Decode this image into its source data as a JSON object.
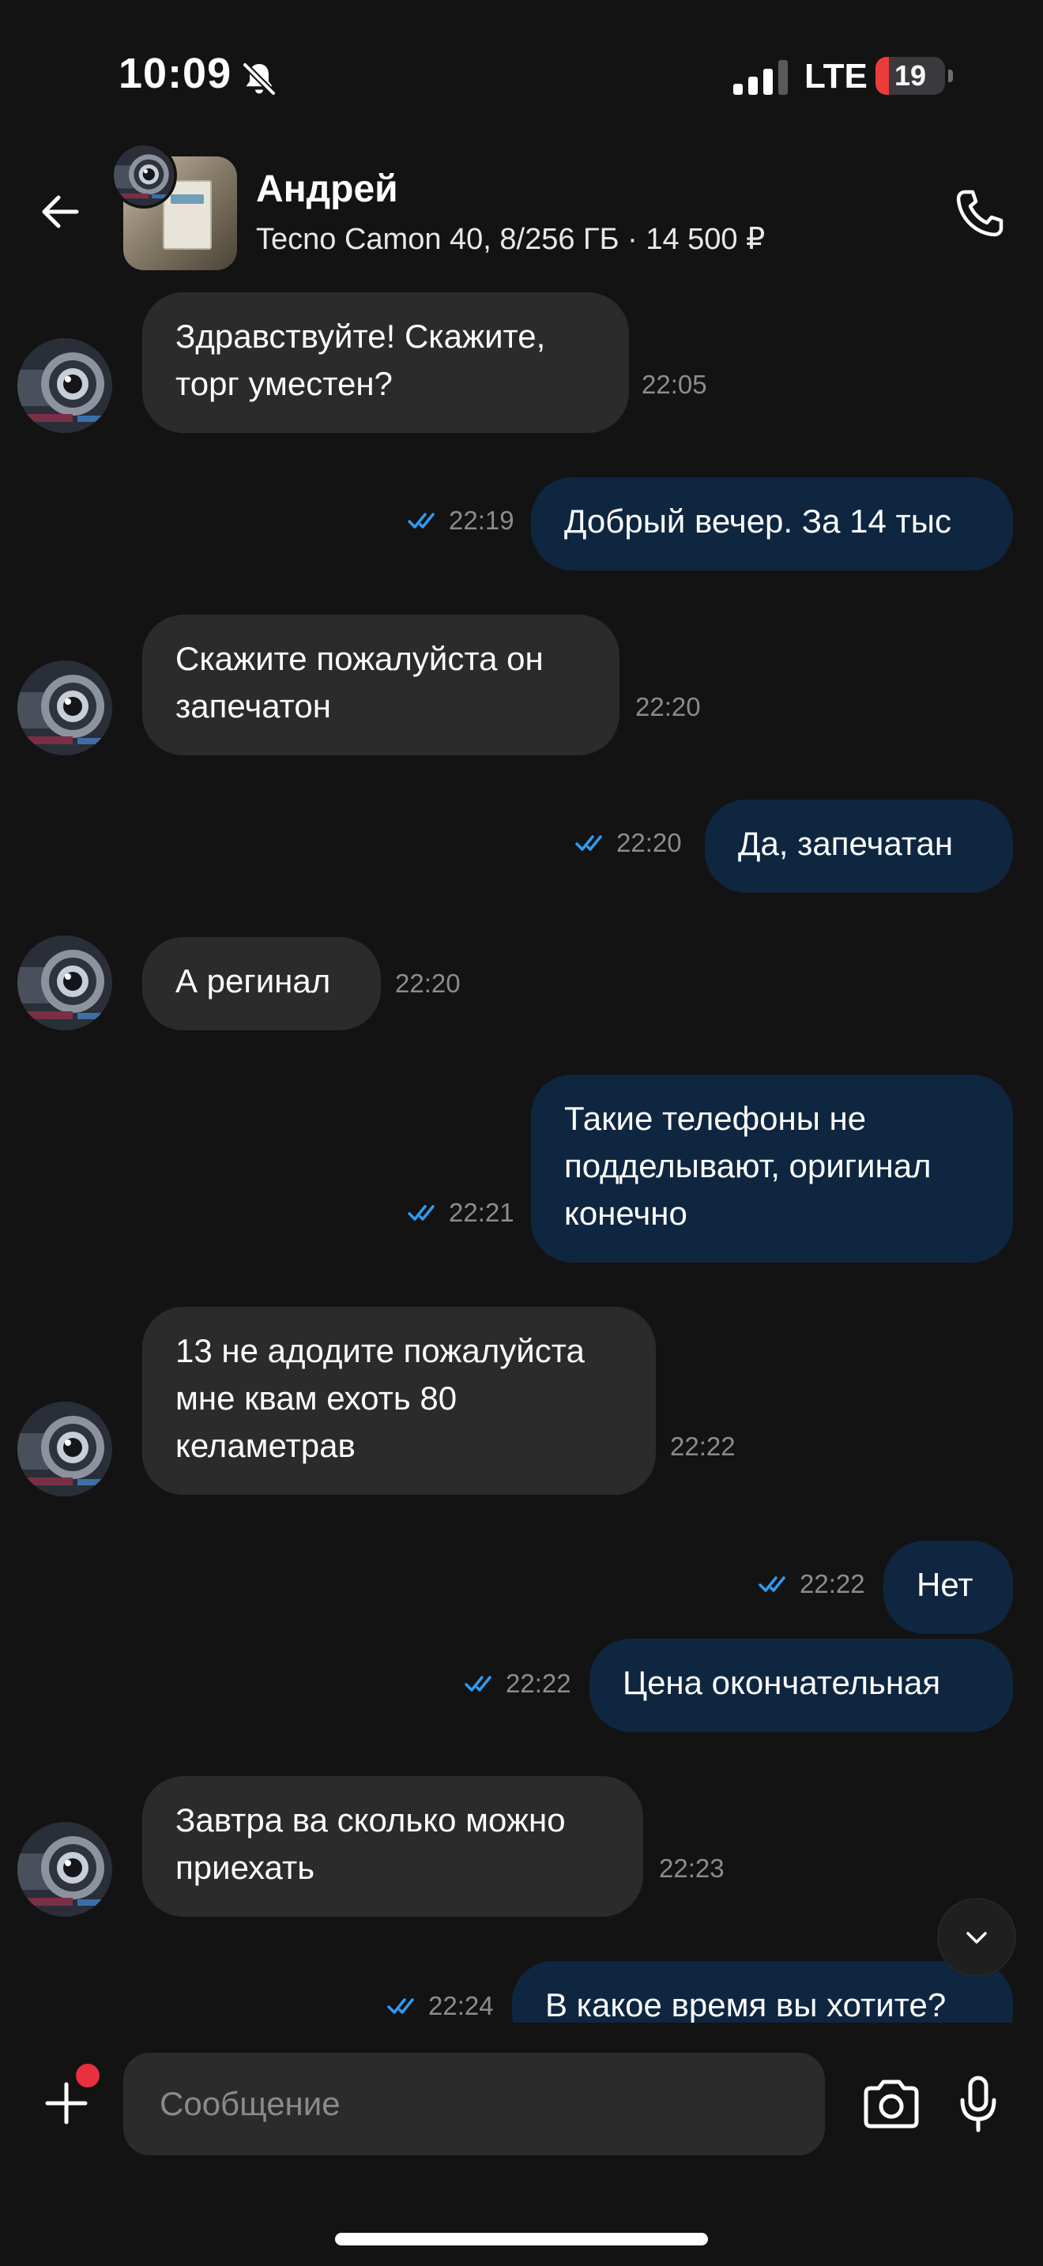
{
  "status_bar": {
    "time": "10:09",
    "network": "LTE",
    "battery_level": "19",
    "battery_fraction": 0.19,
    "battery_color": "#eb3b3b",
    "icons": [
      "bell-slash-icon",
      "signal-icon"
    ]
  },
  "header": {
    "contact_name": "Андрей",
    "listing_title": "Tecno Camon 40, 8/256 ГБ · 14 500 ₽",
    "icons": [
      "back-arrow-icon",
      "phone-icon"
    ]
  },
  "colors": {
    "background": "#131313",
    "incoming_bubble": "#2b2b2b",
    "outgoing_bubble": "#0f2640",
    "read_check": "#2f9bf2",
    "timestamp": "#8c8c8c"
  },
  "messages": [
    {
      "direction": "in",
      "text": "Здравствуйте! Скажите,\nторг уместен?",
      "time": "22:05"
    },
    {
      "direction": "out",
      "text": "Добрый вечер. За 14 тыс",
      "time": "22:19",
      "read": true
    },
    {
      "direction": "in",
      "text": "Скажите пожалуйста он\nзапечатон",
      "time": "22:20"
    },
    {
      "direction": "out",
      "text": "Да, запечатан",
      "time": "22:20",
      "read": true
    },
    {
      "direction": "in",
      "text": "А регинал",
      "time": "22:20"
    },
    {
      "direction": "out",
      "text": "Такие телефоны не\nподделывают, оригинал\nконечно",
      "time": "22:21",
      "read": true
    },
    {
      "direction": "in",
      "text": "13 не адодите пожалуйста\nмне квам ехоть 80\nкеламетрав",
      "time": "22:22"
    },
    {
      "direction": "out",
      "text": "Нет",
      "time": "22:22",
      "read": true
    },
    {
      "direction": "out",
      "text": "Цена окончательная",
      "time": "22:22",
      "read": true
    },
    {
      "direction": "in",
      "text": "Завтра ва сколько можно\nприехать",
      "time": "22:23"
    },
    {
      "direction": "out",
      "text": "В какое время вы хотите?",
      "time": "22:24",
      "read": true
    }
  ],
  "composer": {
    "placeholder": "Сообщение",
    "icons": [
      "plus-icon",
      "camera-icon",
      "microphone-icon"
    ]
  }
}
